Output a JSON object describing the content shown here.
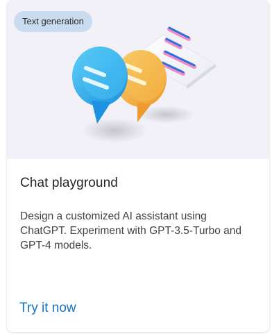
{
  "card": {
    "badge": "Text generation",
    "title": "Chat playground",
    "description": "Design a customized AI assistant using ChatGPT. Experiment with GPT-3.5-Turbo and GPT-4 models.",
    "cta_label": "Try it now",
    "illustration": "chat-bubbles-illustration"
  },
  "colors": {
    "hero_background": "#f2f1f8",
    "badge_background": "#c8dbef",
    "link": "#1672c4",
    "bubble_blue": "#2ea6e8",
    "bubble_orange": "#f3a93a",
    "line_blue": "#2f6fe0",
    "line_pink": "#f08bc3"
  }
}
